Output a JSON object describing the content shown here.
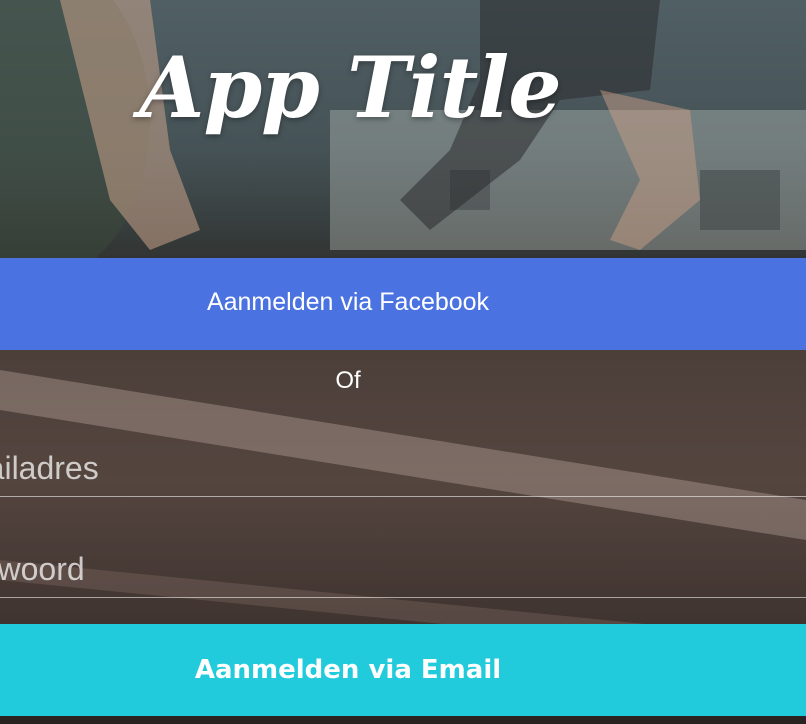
{
  "app": {
    "title": "App Title"
  },
  "facebook_button": {
    "label": "Aanmelden via Facebook"
  },
  "divider": {
    "label": "Of"
  },
  "email_field": {
    "placeholder": "E-mailadres"
  },
  "password_field": {
    "placeholder": "Wachtwoord"
  },
  "email_button": {
    "label": "Aanmelden via Email"
  },
  "colors": {
    "facebook": "#4a72e0",
    "email": "#22cbdc",
    "text": "#ffffff"
  }
}
